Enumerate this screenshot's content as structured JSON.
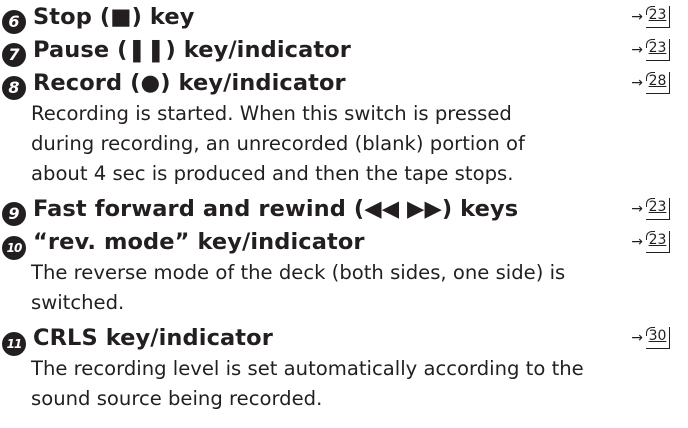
{
  "items": [
    {
      "number": "6",
      "title": "Stop (■) key",
      "page": "23",
      "desc": []
    },
    {
      "number": "7",
      "title": "Pause (❚❚) key/indicator",
      "page": "23",
      "desc": []
    },
    {
      "number": "8",
      "title": "Record (●) key/indicator",
      "page": "28",
      "desc": [
        "Recording is started. When this switch is pressed",
        "during recording, an unrecorded (blank) portion of",
        "about 4 sec is produced and then the tape stops."
      ]
    },
    {
      "number": "9",
      "title": "Fast forward and rewind (◀◀ ▶▶) keys",
      "page": "23",
      "desc": []
    },
    {
      "number": "10",
      "title": "“rev. mode” key/indicator",
      "page": "23",
      "desc": [
        "The reverse mode of the deck (both sides, one side) is",
        "switched."
      ]
    },
    {
      "number": "11",
      "title": "CRLS key/indicator",
      "page": "30",
      "desc": [
        "The recording level is set automatically according to the",
        "sound source being recorded."
      ]
    }
  ],
  "arrow_glyph": "→"
}
